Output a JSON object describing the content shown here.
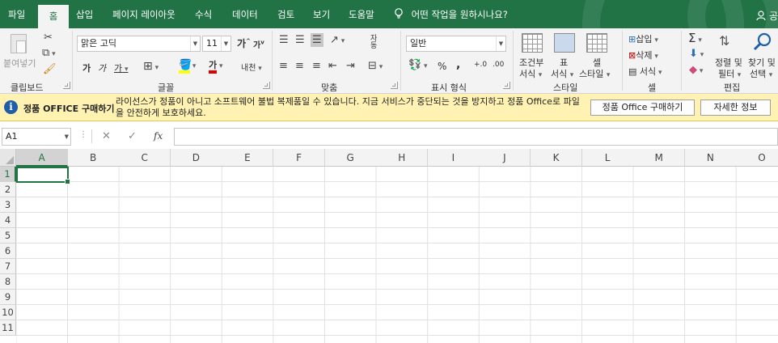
{
  "menu": {
    "tabs": [
      "파일",
      "홈",
      "삽입",
      "페이지 레이아웃",
      "수식",
      "데이터",
      "검토",
      "보기",
      "도움말"
    ],
    "active_tab": "홈",
    "tell_me": "어떤 작업을 원하시나요?",
    "share": "공",
    "share_icon": "person-icon"
  },
  "ribbon": {
    "clipboard": {
      "label": "클립보드",
      "paste": "붙여넣기",
      "cut_icon": "scissors-icon",
      "copy_icon": "copy-icon",
      "painter_icon": "format-painter-icon"
    },
    "font": {
      "label": "글꼴",
      "name": "맑은 고딕",
      "size": "11",
      "grow": "가",
      "shrink": "가",
      "bold": "가",
      "italic": "가",
      "underline": "가",
      "font_color_char": "가",
      "phonetic": "내천"
    },
    "align": {
      "label": "맞춤",
      "wrap": "자동"
    },
    "number": {
      "label": "표시 형식",
      "format": "일반",
      "percent": "%",
      "comma": ",",
      "inc": "+.0",
      "dec": ".00"
    },
    "styles": {
      "label": "스타일",
      "cond_1": "조건부",
      "cond_2": "서식 ",
      "table_1": "표",
      "table_2": "서식 ",
      "cell_1": "셀",
      "cell_2": "스타일 "
    },
    "cells": {
      "label": "셀",
      "insert": "삽입",
      "delete": "삭제",
      "format": "서식"
    },
    "editing": {
      "label": "편집",
      "sort_1": "정렬 및",
      "sort_2": "필터 ",
      "find_1": "찾기 및",
      "find_2": "선택 ",
      "sigma": "Σ"
    }
  },
  "message": {
    "title": "정품 OFFICE 구매하기",
    "text": "라이선스가 정품이 아니고 소프트웨어 불법 복제품일 수 있습니다. 지금 서비스가 중단되는 것을 방지하고 정품 Office로 파일을 안전하게 보호하세요.",
    "buy_button": "정품 Office 구매하기",
    "details_button": "자세한 정보",
    "info_icon": "i"
  },
  "formula": {
    "name_box": "A1",
    "cancel": "✕",
    "enter": "✓",
    "fx": "fx",
    "value": ""
  },
  "sheet": {
    "columns": [
      "A",
      "B",
      "C",
      "D",
      "E",
      "F",
      "G",
      "H",
      "I",
      "J",
      "K",
      "L",
      "M",
      "N",
      "O"
    ],
    "rows": [
      "1",
      "2",
      "3",
      "4",
      "5",
      "6",
      "7",
      "8",
      "9",
      "10",
      "11"
    ],
    "active_cell": "A1",
    "accent": "#217346"
  }
}
